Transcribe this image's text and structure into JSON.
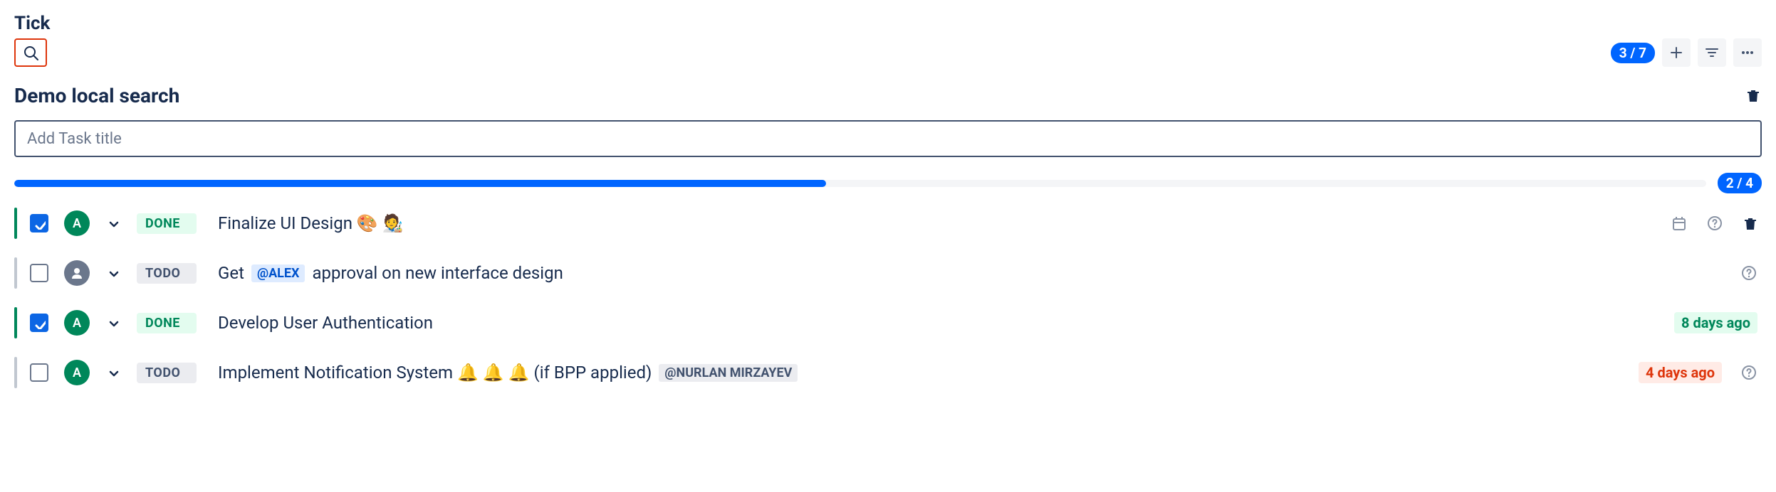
{
  "app_title": "Tick",
  "header": {
    "count_badge": "3 / 7"
  },
  "section": {
    "title": "Demo local search",
    "add_placeholder": "Add Task title",
    "progress_badge": "2 / 4",
    "progress_percent": 48
  },
  "tasks": [
    {
      "checked": true,
      "accent": "green",
      "avatar": {
        "type": "initial",
        "value": "A",
        "color": "green"
      },
      "status": {
        "label": "DONE",
        "kind": "done"
      },
      "title_parts": [
        {
          "t": "text",
          "v": "Finalize UI Design 🎨 🧑‍🎨"
        }
      ],
      "show_date_icon": true,
      "show_help": true,
      "show_delete": true
    },
    {
      "checked": false,
      "accent": "grey",
      "avatar": {
        "type": "placeholder",
        "color": "grey"
      },
      "status": {
        "label": "TODO",
        "kind": "todo"
      },
      "title_parts": [
        {
          "t": "text",
          "v": "Get "
        },
        {
          "t": "mention",
          "v": "@ALEX",
          "style": "blue"
        },
        {
          "t": "text",
          "v": " approval on new interface design"
        }
      ],
      "show_help": true
    },
    {
      "checked": true,
      "accent": "green",
      "avatar": {
        "type": "initial",
        "value": "A",
        "color": "green"
      },
      "status": {
        "label": "DONE",
        "kind": "done"
      },
      "title_parts": [
        {
          "t": "text",
          "v": "Develop User Authentication"
        }
      ],
      "due": {
        "label": "8 days ago",
        "kind": "green"
      }
    },
    {
      "checked": false,
      "accent": "grey",
      "avatar": {
        "type": "initial",
        "value": "A",
        "color": "green"
      },
      "status": {
        "label": "TODO",
        "kind": "todo"
      },
      "title_parts": [
        {
          "t": "text",
          "v": "Implement Notification System 🔔 🔔 🔔 (if BPP applied) "
        },
        {
          "t": "mention",
          "v": "@NURLAN MIRZAYEV",
          "style": "grey"
        }
      ],
      "due": {
        "label": "4 days ago",
        "kind": "red"
      },
      "show_help": true
    }
  ]
}
